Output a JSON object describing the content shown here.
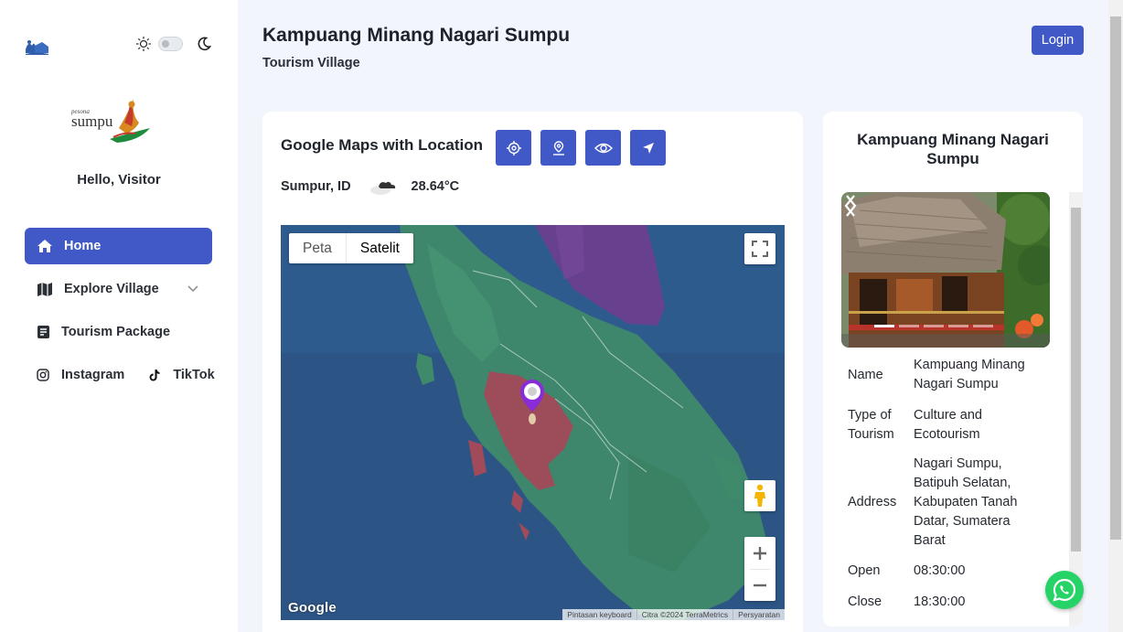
{
  "sidebar": {
    "brand_icon": "village-logo-icon",
    "theme_toggle": {
      "light_icon": "sun-icon",
      "dark_icon": "moon-icon",
      "state": "light"
    },
    "logo_name": "sumpu-logo",
    "logo_text_small": "pesona",
    "logo_text_main": "sumpu",
    "greeting": "Hello, Visitor",
    "nav": [
      {
        "label": "Home",
        "icon": "home-icon",
        "active": true
      },
      {
        "label": "Explore Village",
        "icon": "map-icon",
        "has_dropdown": true
      },
      {
        "label": "Tourism Package",
        "icon": "package-icon"
      }
    ],
    "social": [
      {
        "label": "Instagram",
        "icon": "instagram-icon"
      },
      {
        "label": "TikTok",
        "icon": "tiktok-icon"
      }
    ]
  },
  "header": {
    "title": "Kampuang Minang Nagari Sumpu",
    "subtitle": "Tourism Village",
    "login_label": "Login"
  },
  "map_card": {
    "title": "Google Maps with Location",
    "tools": [
      "current-location-icon",
      "pin-icon",
      "view-icon",
      "navigate-icon"
    ],
    "weather": {
      "location": "Sumpur, ID",
      "icon": "cloud-icon",
      "temperature": "28.64°C"
    },
    "map": {
      "type_options": [
        "Peta",
        "Satelit"
      ],
      "selected_type": "Satelit",
      "google_label": "Google",
      "attribution": [
        "Pintasan keyboard",
        "Citra ©2024 TerraMetrics",
        "Persyaratan"
      ]
    }
  },
  "info_card": {
    "title": "Kampuang Minang Nagari Sumpu",
    "carousel": {
      "slide_count": 5,
      "active_index": 0
    },
    "details": [
      {
        "key": "Name",
        "value": "Kampuang Minang Nagari Sumpu"
      },
      {
        "key": "Type of Tourism",
        "value": "Culture and Ecotourism"
      },
      {
        "key": "Address",
        "value": "Nagari Sumpu, Batipuh Selatan, Kabupaten Tanah Datar, Sumatera Barat"
      },
      {
        "key": "Open",
        "value": "08:30:00"
      },
      {
        "key": "Close",
        "value": "18:30:00"
      }
    ]
  },
  "colors": {
    "accent": "#4158c7",
    "background": "#f2f6fc",
    "whatsapp": "#25d366"
  },
  "whatsapp_icon": "whatsapp-icon"
}
